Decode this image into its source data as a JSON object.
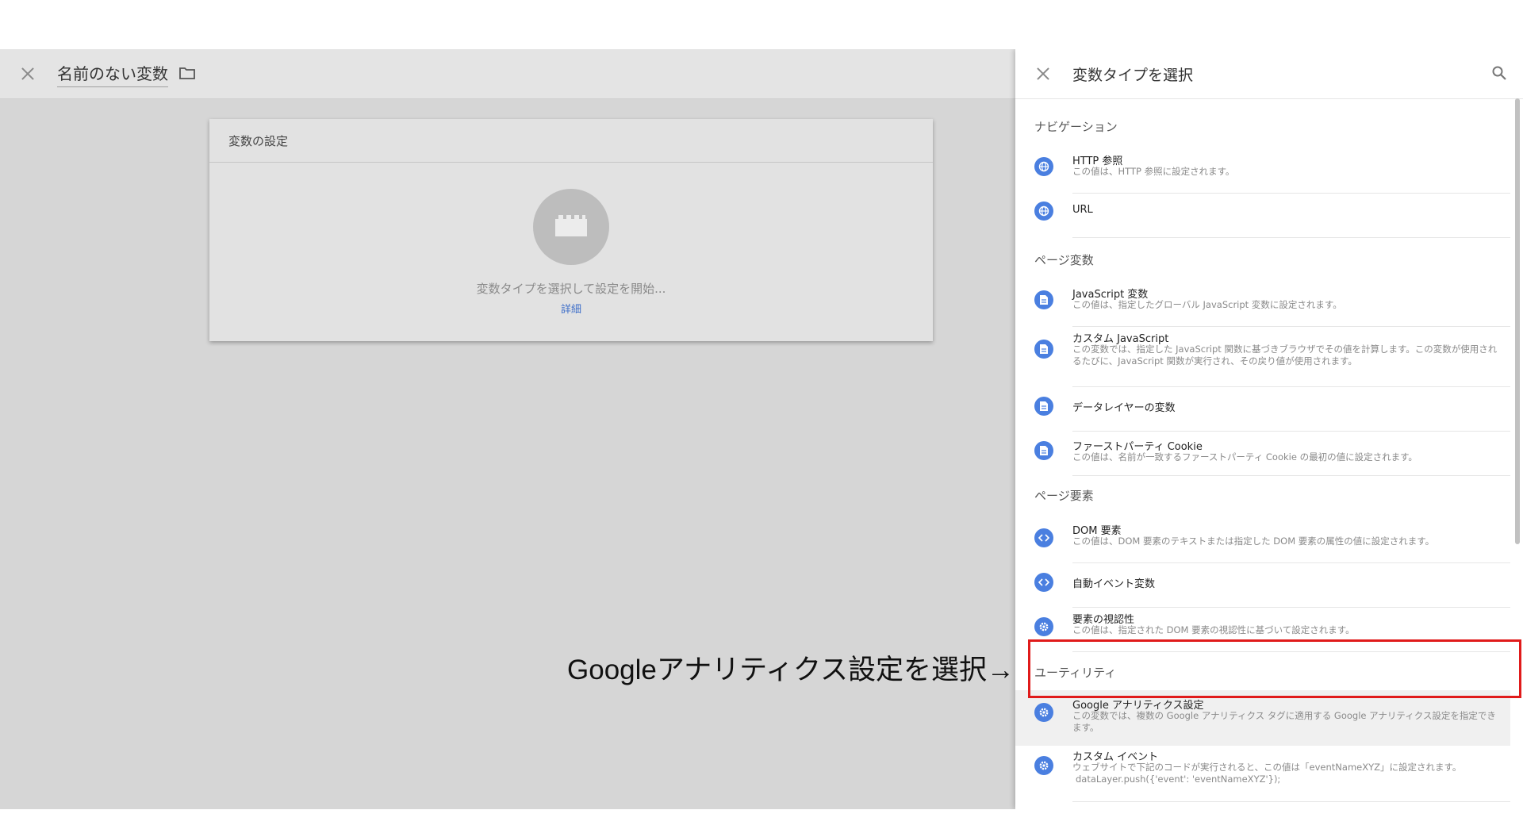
{
  "editor": {
    "title": "名前のない変数",
    "card_title": "変数の設定",
    "hint": "変数タイプを選択して設定を開始...",
    "link": "詳細"
  },
  "panel": {
    "title": "変数タイプを選択",
    "sections": {
      "navigation": "ナビゲーション",
      "page_vars": "ページ変数",
      "page_elements": "ページ要素",
      "utilities": "ユーティリティ"
    },
    "items": [
      {
        "title": "HTTP 参照",
        "desc": "この値は、HTTP 参照に設定されます。",
        "icon": "globe-icon"
      },
      {
        "title": "URL",
        "desc": "",
        "icon": "globe-icon"
      },
      {
        "title": "JavaScript 変数",
        "desc": "この値は、指定したグローバル JavaScript 変数に設定されます。",
        "icon": "document-icon"
      },
      {
        "title": "カスタム JavaScript",
        "desc": "この変数では、指定した JavaScript 関数に基づきブラウザでその値を計算します。この変数が使用されるたびに、JavaScript 関数が実行され、その戻り値が使用されます。",
        "icon": "document-icon"
      },
      {
        "title": "データレイヤーの変数",
        "desc": "",
        "icon": "document-icon"
      },
      {
        "title": "ファーストパーティ Cookie",
        "desc": "この値は、名前が一致するファーストパーティ Cookie の最初の値に設定されます。",
        "icon": "document-icon"
      },
      {
        "title": "DOM 要素",
        "desc": "この値は、DOM 要素のテキストまたは指定した DOM 要素の属性の値に設定されます。",
        "icon": "code-icon"
      },
      {
        "title": "自動イベント変数",
        "desc": "",
        "icon": "code-icon"
      },
      {
        "title": "要素の視認性",
        "desc": "この値は、指定された DOM 要素の視認性に基づいて設定されます。",
        "icon": "gear-icon"
      },
      {
        "title": "Google アナリティクス設定",
        "desc": "この変数では、複数の Google アナリティクス タグに適用する Google アナリティクス設定を指定できます。",
        "icon": "gear-icon"
      },
      {
        "title": "カスタム イベント",
        "desc": "ウェブサイトで下記のコードが実行されると、この値は「eventNameXYZ」に設定されます。",
        "desc2": "dataLayer.push({'event': 'eventNameXYZ'});",
        "icon": "gear-icon"
      }
    ]
  },
  "annotation": "Googleアナリティクス設定を選択→",
  "colors": {
    "accent": "#4a7fe0",
    "highlight": "#e01b1b",
    "link": "#3f6fc9"
  }
}
